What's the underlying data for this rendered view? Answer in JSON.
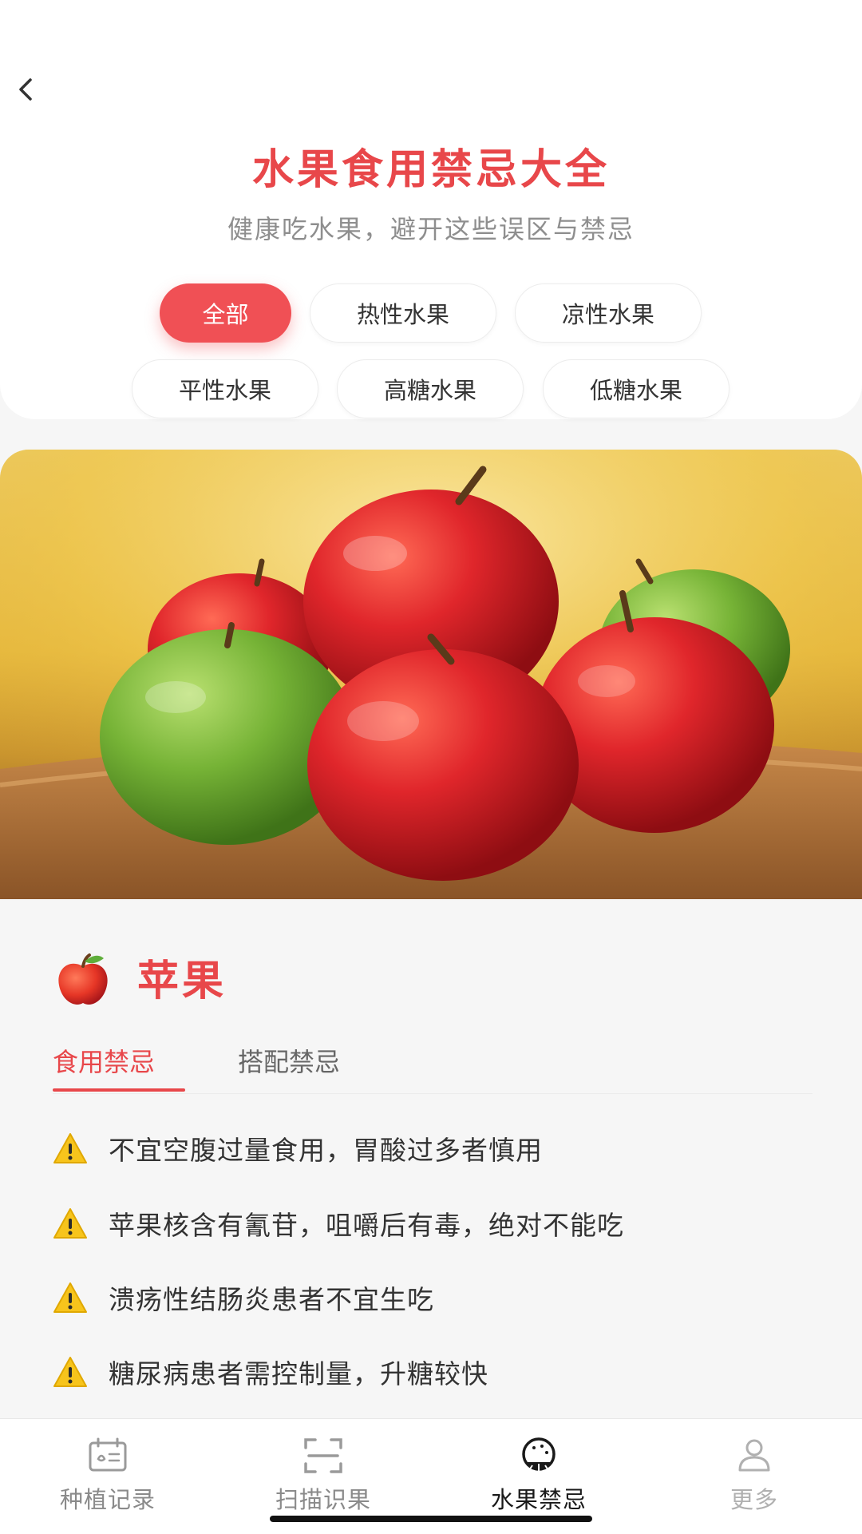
{
  "header": {
    "title": "水果食用禁忌大全",
    "subtitle": "健康吃水果，避开这些误区与禁忌"
  },
  "filters": [
    {
      "label": "全部",
      "active": true
    },
    {
      "label": "热性水果",
      "active": false
    },
    {
      "label": "凉性水果",
      "active": false
    },
    {
      "label": "平性水果",
      "active": false
    },
    {
      "label": "高糖水果",
      "active": false
    },
    {
      "label": "低糖水果",
      "active": false
    }
  ],
  "fruit": {
    "name": "苹果",
    "icon": "apple-emoji-icon"
  },
  "tabs": [
    {
      "label": "食用禁忌",
      "active": true
    },
    {
      "label": "搭配禁忌",
      "active": false
    }
  ],
  "taboos": [
    "不宜空腹过量食用，胃酸过多者慎用",
    "苹果核含有氰苷，咀嚼后有毒，绝对不能吃",
    "溃疡性结肠炎患者不宜生吃",
    "糖尿病患者需控制量，升糖较快"
  ],
  "nav": [
    {
      "label": "种植记录",
      "icon": "planting-calendar-icon",
      "active": false
    },
    {
      "label": "扫描识果",
      "icon": "scan-icon",
      "active": false
    },
    {
      "label": "水果禁忌",
      "icon": "fruit-icon",
      "active": true
    },
    {
      "label": "更多",
      "icon": "user-icon",
      "active": false
    }
  ],
  "colors": {
    "accent": "#e8474a",
    "chip_active": "#f05055"
  }
}
